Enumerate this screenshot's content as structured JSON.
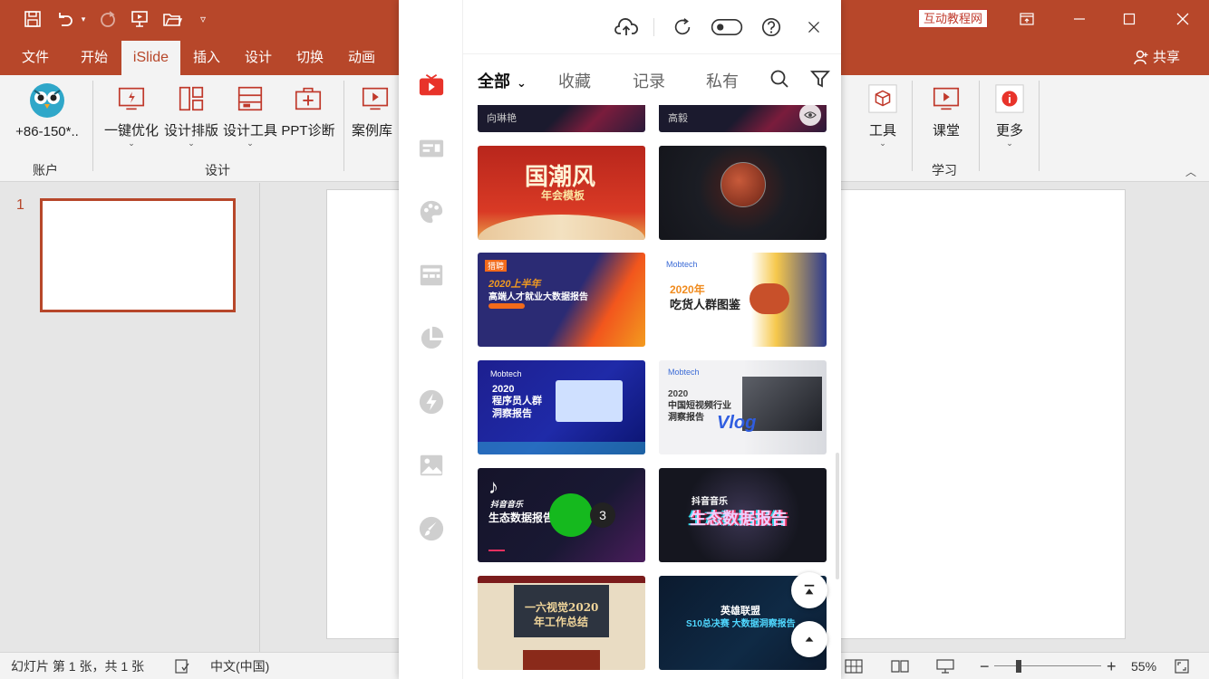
{
  "titlebar": {
    "edu_badge": "互动教程网"
  },
  "tabs": {
    "file": "文件",
    "home": "开始",
    "islide": "iSlide",
    "insert": "插入",
    "design": "设计",
    "transitions": "切换",
    "animations": "动画",
    "share": "共享"
  },
  "ribbon": {
    "account_label": "+86-150*..",
    "group_account": "账户",
    "btn_optimize": "一键优化",
    "btn_layout": "设计排版",
    "btn_tools": "设计工具",
    "btn_diagnose": "PPT诊断",
    "group_design": "设计",
    "btn_cases": "案例库",
    "btn_tool": "工具",
    "btn_class": "课堂",
    "btn_more": "更多",
    "group_learn": "学习"
  },
  "slides": {
    "number": "1"
  },
  "statusbar": {
    "slide_info": "幻灯片 第 1 张，共 1 张",
    "language": "中文(中国)",
    "zoom": "55%"
  },
  "panel": {
    "filter_tabs": [
      "全部",
      "收藏",
      "记录",
      "私有"
    ],
    "top_cards": [
      "向琳艳",
      "高毅"
    ],
    "cards": [
      {
        "title": "国潮风",
        "subtitle": "年会模板"
      },
      {
        "title": "",
        "subtitle": ""
      },
      {
        "title": "2020上半年",
        "subtitle": "高端人才就业大数据报告"
      },
      {
        "title": "2020年",
        "subtitle": "吃货人群图鉴"
      },
      {
        "title": "2020",
        "subtitle": "程序员人群洞察报告"
      },
      {
        "title": "2020",
        "subtitle": "中国短视频行业洞察报告",
        "extra": "Vlog"
      },
      {
        "title": "抖音音乐",
        "subtitle": "生态数据报告"
      },
      {
        "title": "抖音音乐",
        "subtitle": "生态数据报告"
      },
      {
        "title": "一六视觉2020",
        "subtitle": "年工作总结"
      },
      {
        "title": "英雄联盟",
        "subtitle": "S10总决赛 大数据洞察报告"
      }
    ],
    "overlay_badge": "3"
  },
  "colors": {
    "accent": "#b7472a",
    "panel_red": "#e8332a"
  }
}
